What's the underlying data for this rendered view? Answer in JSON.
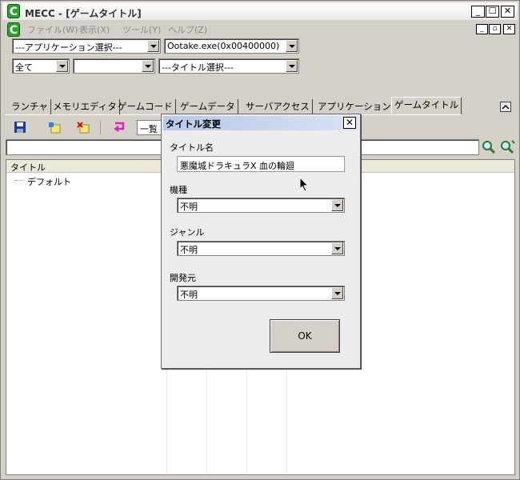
{
  "window": {
    "title": "MECC - [ゲームタイトル]"
  },
  "menu": {
    "file": "ファイル(W)",
    "view": "表示(X)",
    "tools": "ツール(Y)",
    "help": "ヘルプ(Z)"
  },
  "selectors": {
    "app_select": "---アプリケーション選択---",
    "process": "Ootake.exe(0x00400000)",
    "filter_all": "全て",
    "filter_second": "",
    "title_select": "---タイトル選択---"
  },
  "tabs": [
    "ランチャ",
    "メモリエディタ",
    "ゲームコード",
    "ゲームデータ",
    "サーバアクセス",
    "アプリケーション",
    "ゲームタイトル"
  ],
  "toolbar": {
    "list_partial": "一覧"
  },
  "list": {
    "header": "タイトル",
    "items": [
      "デフォルト"
    ]
  },
  "dialog": {
    "title": "タイトル変更",
    "title_name_label": "タイトル名",
    "title_name_value": "悪魔城ドラキュラX 血の輪廻",
    "platform_label": "機種",
    "platform_value": "不明",
    "genre_label": "ジャンル",
    "genre_value": "不明",
    "developer_label": "開発元",
    "developer_value": "不明",
    "ok_label": "OK"
  }
}
